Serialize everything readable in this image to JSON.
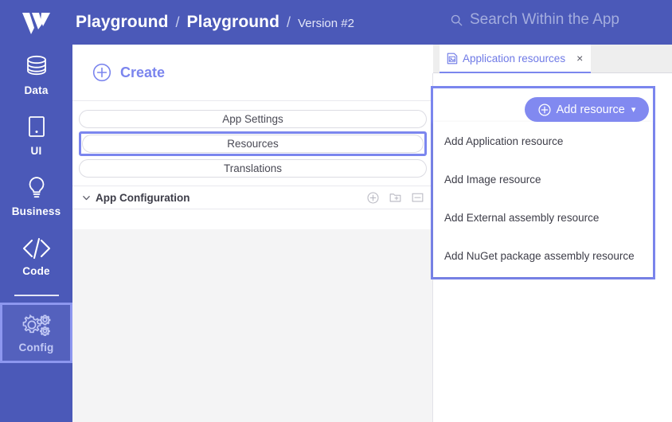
{
  "app": {
    "logo_icon": "w-logo-icon",
    "brand_color": "#4b59b8",
    "accent_color": "#7b86ee",
    "button_color": "#8189f0"
  },
  "header": {
    "breadcrumb": {
      "project": "Playground",
      "separator_1": "/",
      "app": "Playground",
      "separator_2": "/",
      "version": "Version #2"
    },
    "search": {
      "icon": "search-icon",
      "placeholder": "Search Within the App"
    }
  },
  "sidebar": {
    "items": [
      {
        "label": "Data",
        "icon": "database-icon",
        "selected": false
      },
      {
        "label": "UI",
        "icon": "tablet-icon",
        "selected": false
      },
      {
        "label": "Business",
        "icon": "lightbulb-icon",
        "selected": false
      },
      {
        "label": "Code",
        "icon": "code-brackets-icon",
        "selected": false
      },
      {
        "label": "Config",
        "icon": "gears-icon",
        "selected": true
      }
    ]
  },
  "editor": {
    "create_label": "Create",
    "create_icon": "plus-circle-icon",
    "buttons": [
      {
        "label": "App Settings",
        "highlighted": false
      },
      {
        "label": "Resources",
        "highlighted": true
      },
      {
        "label": "Translations",
        "highlighted": false
      }
    ],
    "section": {
      "title": "App Configuration",
      "chevron_icon": "chevron-down-icon",
      "actions": [
        {
          "icon": "plus-circle-icon",
          "name": "add-item"
        },
        {
          "icon": "folder-plus-icon",
          "name": "add-folder"
        },
        {
          "icon": "collapse-icon",
          "name": "collapse-all"
        }
      ]
    }
  },
  "right_pane": {
    "tab": {
      "label": "Application resources",
      "icon": "image-document-icon",
      "close_glyph": "×"
    },
    "add_resource": {
      "label": "Add resource",
      "icon": "plus-circle-icon",
      "caret": "⌄"
    },
    "menu": {
      "items": [
        {
          "label": "Add Application resource"
        },
        {
          "label": "Add Image resource"
        },
        {
          "label": "Add External assembly resource"
        },
        {
          "label": "Add NuGet package assembly resource"
        }
      ]
    }
  }
}
